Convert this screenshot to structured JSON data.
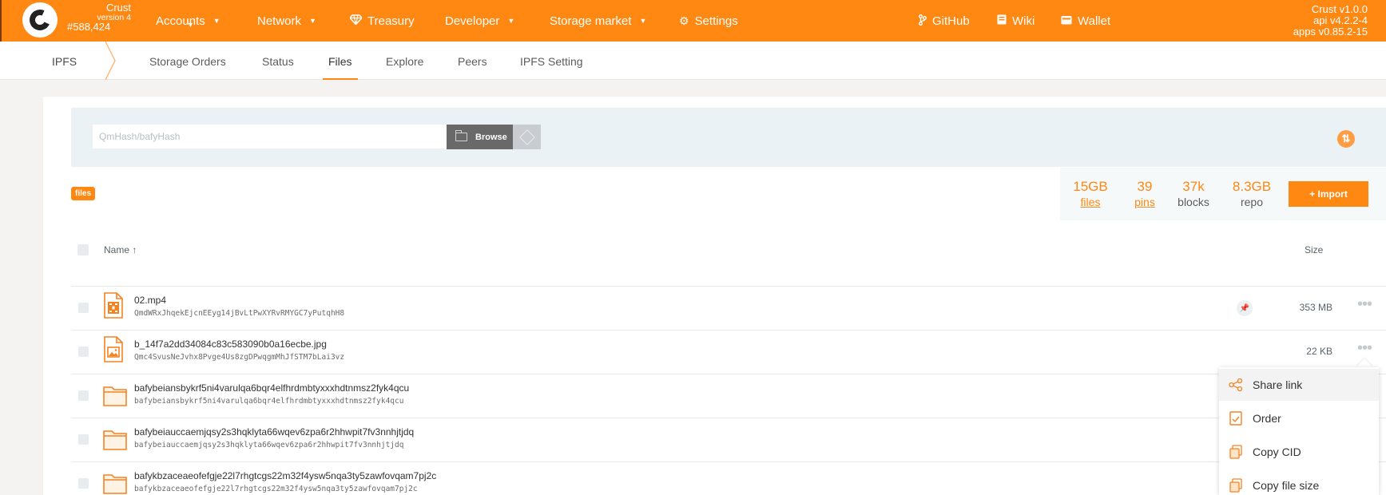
{
  "topbar": {
    "chain_name": "Crust",
    "chain_version": "version 4",
    "block_number": "#588,424",
    "nav": [
      {
        "label": "Accounts",
        "dropdown": true
      },
      {
        "label": "Network",
        "dropdown": true
      },
      {
        "label": "Treasury",
        "icon": "gem-icon"
      },
      {
        "label": "Developer",
        "dropdown": true
      },
      {
        "label": "Storage market",
        "dropdown": true
      },
      {
        "label": "Settings",
        "icon": "gears-icon"
      }
    ],
    "links": [
      {
        "label": "GitHub",
        "icon": "code-branch-icon"
      },
      {
        "label": "Wiki",
        "icon": "book-icon"
      },
      {
        "label": "Wallet",
        "icon": "wallet-icon"
      }
    ],
    "versions": [
      "Crust v1.0.0",
      "api v4.2.2-4",
      "apps v0.85.2-15"
    ]
  },
  "subnav": {
    "section": "IPFS",
    "tabs": [
      "Storage Orders",
      "Status",
      "Files",
      "Explore",
      "Peers",
      "IPFS Setting"
    ],
    "active_tab": "Files"
  },
  "search": {
    "placeholder": "QmHash/bafyHash",
    "browse_label": "Browse"
  },
  "breadcrumb_tag": "files",
  "stats": [
    {
      "value": "15GB",
      "label": "files",
      "link": true
    },
    {
      "value": "39",
      "label": "pins",
      "link": true
    },
    {
      "value": "37k",
      "label": "blocks",
      "link": false
    },
    {
      "value": "8.3GB",
      "label": "repo",
      "link": false
    }
  ],
  "import_label": "+ Import",
  "table": {
    "col_name": "Name ↑",
    "col_size": "Size",
    "rows": [
      {
        "name": "02.mp4",
        "cid": "QmdWRxJhqekEjcnEEyg14jBvLtPwXYRvRMYGC7yPutqhH8",
        "size": "353 MB",
        "type": "video",
        "pinned": true
      },
      {
        "name": "b_14f7a2dd34084c83c583090b0a16ecbe.jpg",
        "cid": "Qmc4SvusNeJvhx8Pvge4Us8zgDPwqgmMhJfSTM7bLai3vz",
        "size": "22 KB",
        "type": "image",
        "pinned": false
      },
      {
        "name": "bafybeiansbykrf5ni4varulqa6bqr4elfhrdmbtyxxxhdtnmsz2fyk4qcu",
        "cid": "bafybeiansbykrf5ni4varulqa6bqr4elfhrdmbtyxxxhdtnmsz2fyk4qcu",
        "size": "",
        "type": "folder",
        "pinned": false
      },
      {
        "name": "bafybeiauccaemjqsy2s3hqklyta66wqev6zpa6r2hhwpit7fv3nnhjtjdq",
        "cid": "bafybeiauccaemjqsy2s3hqklyta66wqev6zpa6r2hhwpit7fv3nnhjtjdq",
        "size": "",
        "type": "folder",
        "pinned": false
      },
      {
        "name": "bafykbzaceaeofefgje22l7rhgtcgs22m32f4ysw5nqa3ty5zawfovqam7pj2c",
        "cid": "bafykbzaceaeofefgje22l7rhgtcgs22m32f4ysw5nqa3ty5zawfovqam7pj2c",
        "size": "",
        "type": "folder",
        "pinned": false
      }
    ]
  },
  "context_menu": {
    "items": [
      {
        "label": "Share link",
        "icon": "share-icon"
      },
      {
        "label": "Order",
        "icon": "order-icon"
      },
      {
        "label": "Copy CID",
        "icon": "copy-icon"
      },
      {
        "label": "Copy file size",
        "icon": "copy-icon"
      }
    ]
  },
  "colors": {
    "accent": "#ff8812",
    "search_bg": "#ebf2f5",
    "stats_bg": "#f5f9fa"
  }
}
